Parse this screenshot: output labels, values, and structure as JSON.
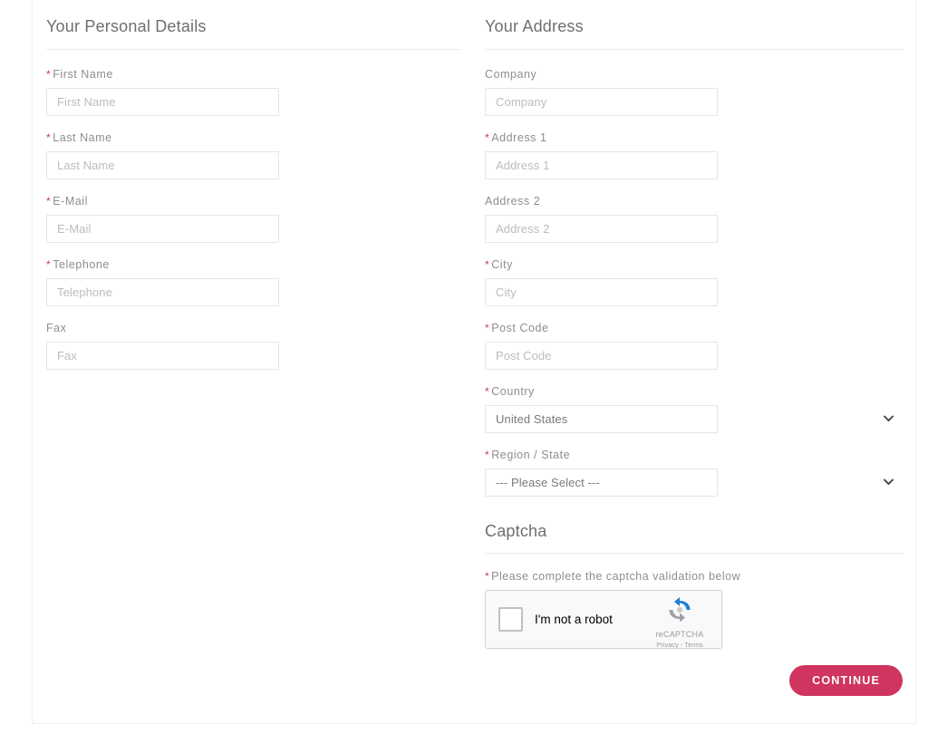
{
  "theme": {
    "accent": "#cf355e",
    "required_asterisk_color": "#d0365e",
    "label_color": "#8e8e8e",
    "legend_color": "#6f6f6f",
    "input_border": "#e6e6e6",
    "placeholder_color": "#bcbcbc",
    "card_border": "#efefef"
  },
  "personal_details": {
    "legend": "Your Personal Details",
    "fields": [
      {
        "label": "First Name",
        "placeholder": "First Name",
        "value": "",
        "required": true,
        "name": "firstname"
      },
      {
        "label": "Last Name",
        "placeholder": "Last Name",
        "value": "",
        "required": true,
        "name": "lastname"
      },
      {
        "label": "E-Mail",
        "placeholder": "E-Mail",
        "value": "",
        "required": true,
        "name": "email"
      },
      {
        "label": "Telephone",
        "placeholder": "Telephone",
        "value": "",
        "required": true,
        "name": "telephone"
      },
      {
        "label": "Fax",
        "placeholder": "Fax",
        "value": "",
        "required": false,
        "name": "fax"
      }
    ]
  },
  "address": {
    "legend": "Your Address",
    "fields": [
      {
        "label": "Company",
        "placeholder": "Company",
        "value": "",
        "required": false,
        "name": "company"
      },
      {
        "label": "Address 1",
        "placeholder": "Address 1",
        "value": "",
        "required": true,
        "name": "address1"
      },
      {
        "label": "Address 2",
        "placeholder": "Address 2",
        "value": "",
        "required": false,
        "name": "address2"
      },
      {
        "label": "City",
        "placeholder": "City",
        "value": "",
        "required": true,
        "name": "city"
      },
      {
        "label": "Post Code",
        "placeholder": "Post Code",
        "value": "",
        "required": true,
        "name": "postcode"
      }
    ],
    "country": {
      "label": "Country",
      "required": true,
      "selected": "United States",
      "options": [
        "United States"
      ]
    },
    "region": {
      "label": "Region / State",
      "required": true,
      "selected": "--- Please Select ---",
      "options": [
        "--- Please Select ---"
      ]
    }
  },
  "captcha": {
    "legend": "Captcha",
    "note": "Please complete the captcha validation below",
    "note_required": true,
    "widget": {
      "checkbox_label": "I'm not a robot",
      "brand": "reCAPTCHA",
      "links": "Privacy - Terms",
      "checked": false
    }
  },
  "footer": {
    "continue_label": "Continue"
  },
  "icons": {
    "chevron_down": "chevron-down-icon",
    "recaptcha_logo": "recaptcha-logo-icon"
  }
}
